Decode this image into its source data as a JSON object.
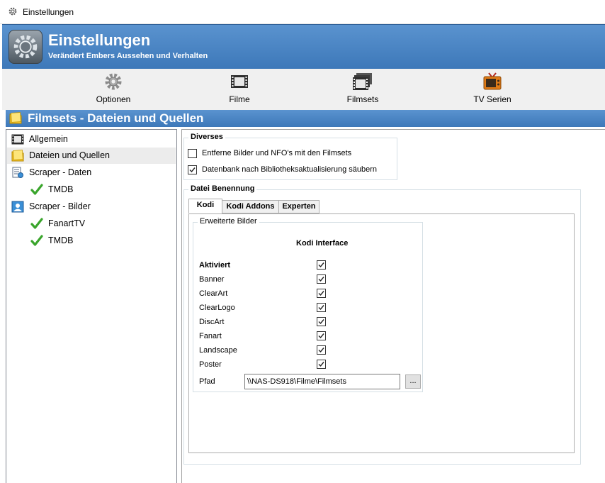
{
  "window": {
    "title": "Einstellungen"
  },
  "header": {
    "title": "Einstellungen",
    "subtitle": "Verändert Embers Aussehen und Verhalten"
  },
  "toolbar": {
    "items": [
      {
        "label": "Optionen",
        "icon": "gear-icon"
      },
      {
        "label": "Filme",
        "icon": "film-icon"
      },
      {
        "label": "Filmsets",
        "icon": "filmset-icon"
      },
      {
        "label": "TV Serien",
        "icon": "tv-icon"
      }
    ]
  },
  "section": {
    "title": "Filmsets - Dateien und Quellen"
  },
  "tree": {
    "items": [
      {
        "label": "Allgemein",
        "icon": "film-icon"
      },
      {
        "label": "Dateien und Quellen",
        "icon": "folder-icon",
        "selected": true
      },
      {
        "label": "Scraper - Daten",
        "icon": "scraper-data-icon"
      },
      {
        "label": "TMDB",
        "icon": "checkmark-icon"
      },
      {
        "label": "Scraper - Bilder",
        "icon": "scraper-images-icon"
      },
      {
        "label": "FanartTV",
        "icon": "checkmark-icon"
      },
      {
        "label": "TMDB",
        "icon": "checkmark-icon"
      }
    ]
  },
  "diverses": {
    "title": "Diverses",
    "options": [
      {
        "label": "Entferne Bilder und NFO's mit den Filmsets",
        "checked": false
      },
      {
        "label": "Datenbank nach Bibliotheksaktualisierung säubern",
        "checked": true
      }
    ]
  },
  "naming": {
    "title": "Datei Benennung",
    "tabs": [
      {
        "label": "Kodi",
        "active": true
      },
      {
        "label": "Kodi Addons"
      },
      {
        "label": "Experten"
      }
    ],
    "extended_images": {
      "title": "Erweiterte Bilder",
      "column_header": "Kodi Interface",
      "rows": [
        {
          "label": "Aktiviert",
          "checked": true
        },
        {
          "label": "Banner",
          "checked": true
        },
        {
          "label": "ClearArt",
          "checked": true
        },
        {
          "label": "ClearLogo",
          "checked": true
        },
        {
          "label": "DiscArt",
          "checked": true
        },
        {
          "label": "Fanart",
          "checked": true
        },
        {
          "label": "Landscape",
          "checked": true
        },
        {
          "label": "Poster",
          "checked": true
        }
      ],
      "path_label": "Pfad",
      "path_value": "\\\\NAS-DS918\\Filme\\Filmsets",
      "browse_label": "..."
    }
  }
}
